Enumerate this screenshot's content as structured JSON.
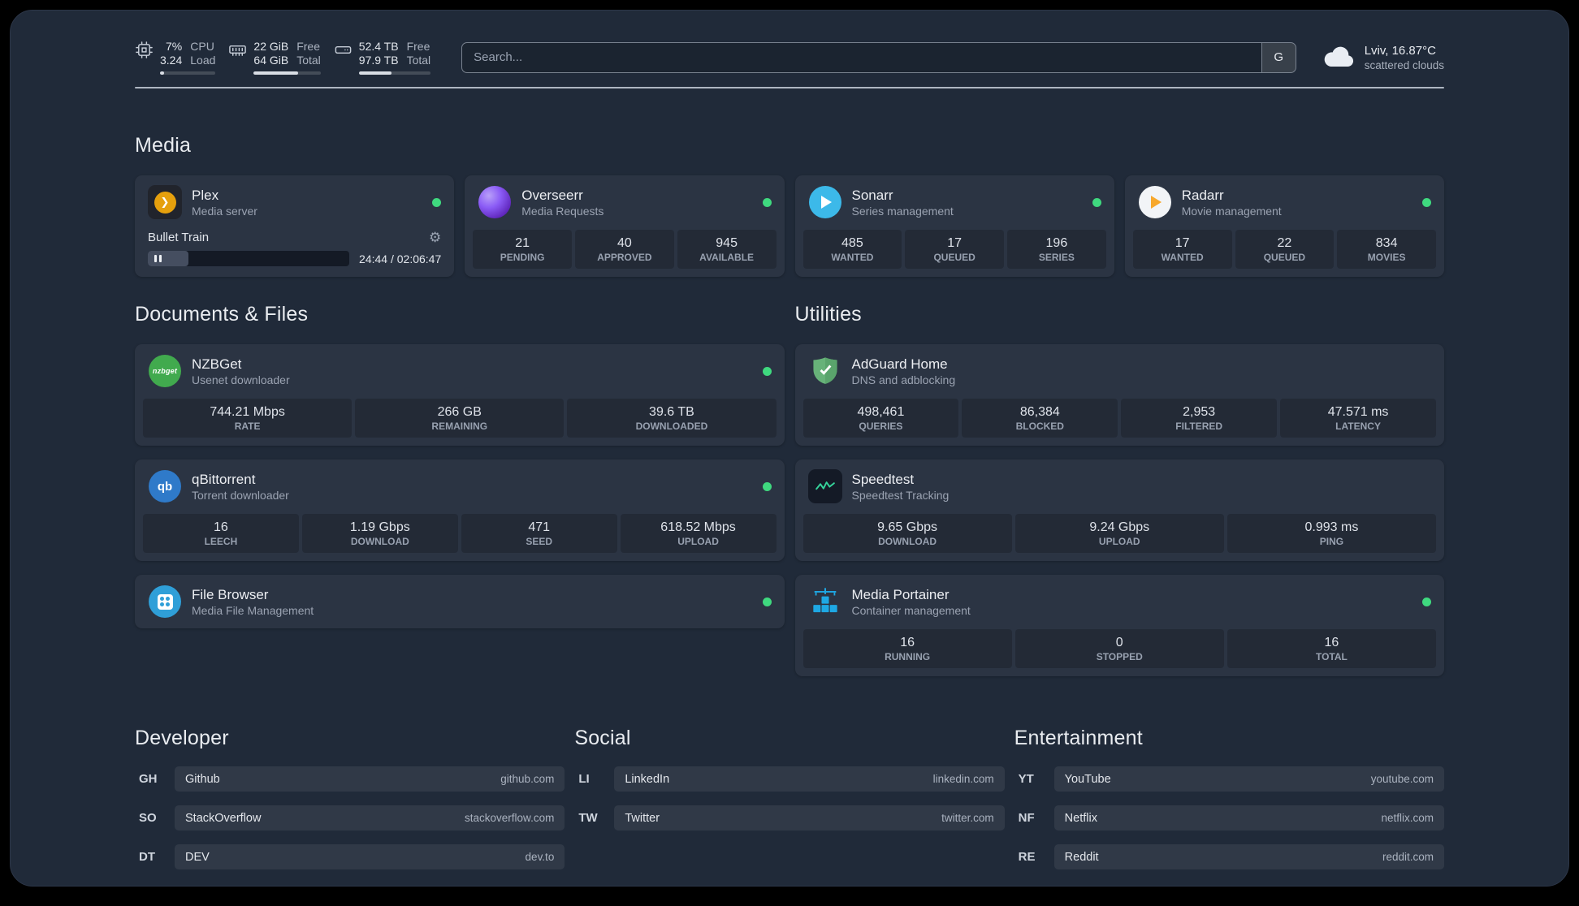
{
  "colors": {
    "status_online": "#3fd97f",
    "accent_plex": "#e5a00d",
    "accent_overseerr": "#8b5cf6",
    "accent_sonarr": "#3cb9e9",
    "accent_radarr": "#f7a82d"
  },
  "topbar": {
    "cpu": {
      "value_top": "7%",
      "value_bottom": "3.24",
      "label_top": "CPU",
      "label_bottom": "Load",
      "bar_pct": 7
    },
    "ram": {
      "value_top": "22 GiB",
      "value_bottom": "64 GiB",
      "label_top": "Free",
      "label_bottom": "Total",
      "bar_pct": 66
    },
    "disk": {
      "value_top": "52.4 TB",
      "value_bottom": "97.9 TB",
      "label_top": "Free",
      "label_bottom": "Total",
      "bar_pct": 46
    },
    "search": {
      "placeholder": "Search...",
      "provider_label": "G"
    },
    "weather": {
      "location": "Lviv, 16.87°C",
      "condition": "scattered clouds"
    }
  },
  "sections": {
    "media": {
      "title": "Media",
      "plex": {
        "name": "Plex",
        "subtitle": "Media server",
        "now_playing": "Bullet Train",
        "elapsed_total": "24:44 / 02:06:47",
        "progress_pct": 20
      },
      "overseerr": {
        "name": "Overseerr",
        "subtitle": "Media Requests",
        "stats": [
          {
            "value": "21",
            "label": "PENDING"
          },
          {
            "value": "40",
            "label": "APPROVED"
          },
          {
            "value": "945",
            "label": "AVAILABLE"
          }
        ]
      },
      "sonarr": {
        "name": "Sonarr",
        "subtitle": "Series management",
        "stats": [
          {
            "value": "485",
            "label": "WANTED"
          },
          {
            "value": "17",
            "label": "QUEUED"
          },
          {
            "value": "196",
            "label": "SERIES"
          }
        ]
      },
      "radarr": {
        "name": "Radarr",
        "subtitle": "Movie management",
        "stats": [
          {
            "value": "17",
            "label": "WANTED"
          },
          {
            "value": "22",
            "label": "QUEUED"
          },
          {
            "value": "834",
            "label": "MOVIES"
          }
        ]
      }
    },
    "documents": {
      "title": "Documents & Files",
      "nzbget": {
        "name": "NZBGet",
        "subtitle": "Usenet downloader",
        "stats": [
          {
            "value": "744.21 Mbps",
            "label": "RATE"
          },
          {
            "value": "266 GB",
            "label": "REMAINING"
          },
          {
            "value": "39.6 TB",
            "label": "DOWNLOADED"
          }
        ]
      },
      "qbittorrent": {
        "name": "qBittorrent",
        "subtitle": "Torrent downloader",
        "stats": [
          {
            "value": "16",
            "label": "LEECH"
          },
          {
            "value": "1.19 Gbps",
            "label": "DOWNLOAD"
          },
          {
            "value": "471",
            "label": "SEED"
          },
          {
            "value": "618.52 Mbps",
            "label": "UPLOAD"
          }
        ]
      },
      "filebrowser": {
        "name": "File Browser",
        "subtitle": "Media File Management"
      }
    },
    "utilities": {
      "title": "Utilities",
      "adguard": {
        "name": "AdGuard Home",
        "subtitle": "DNS and adblocking",
        "stats": [
          {
            "value": "498,461",
            "label": "QUERIES"
          },
          {
            "value": "86,384",
            "label": "BLOCKED"
          },
          {
            "value": "2,953",
            "label": "FILTERED"
          },
          {
            "value": "47.571 ms",
            "label": "LATENCY"
          }
        ]
      },
      "speedtest": {
        "name": "Speedtest",
        "subtitle": "Speedtest Tracking",
        "stats": [
          {
            "value": "9.65 Gbps",
            "label": "DOWNLOAD"
          },
          {
            "value": "9.24 Gbps",
            "label": "UPLOAD"
          },
          {
            "value": "0.993 ms",
            "label": "PING"
          }
        ]
      },
      "portainer": {
        "name": "Media Portainer",
        "subtitle": "Container management",
        "stats": [
          {
            "value": "16",
            "label": "RUNNING"
          },
          {
            "value": "0",
            "label": "STOPPED"
          },
          {
            "value": "16",
            "label": "TOTAL"
          }
        ]
      }
    }
  },
  "bookmarks": {
    "developer": {
      "title": "Developer",
      "items": [
        {
          "abbr": "GH",
          "name": "Github",
          "url": "github.com"
        },
        {
          "abbr": "SO",
          "name": "StackOverflow",
          "url": "stackoverflow.com"
        },
        {
          "abbr": "DT",
          "name": "DEV",
          "url": "dev.to"
        }
      ]
    },
    "social": {
      "title": "Social",
      "items": [
        {
          "abbr": "LI",
          "name": "LinkedIn",
          "url": "linkedin.com"
        },
        {
          "abbr": "TW",
          "name": "Twitter",
          "url": "twitter.com"
        }
      ]
    },
    "entertainment": {
      "title": "Entertainment",
      "items": [
        {
          "abbr": "YT",
          "name": "YouTube",
          "url": "youtube.com"
        },
        {
          "abbr": "NF",
          "name": "Netflix",
          "url": "netflix.com"
        },
        {
          "abbr": "RE",
          "name": "Reddit",
          "url": "reddit.com"
        }
      ]
    }
  },
  "icons": {
    "nzbget_label": "nzbget",
    "qb_label": "qb"
  }
}
